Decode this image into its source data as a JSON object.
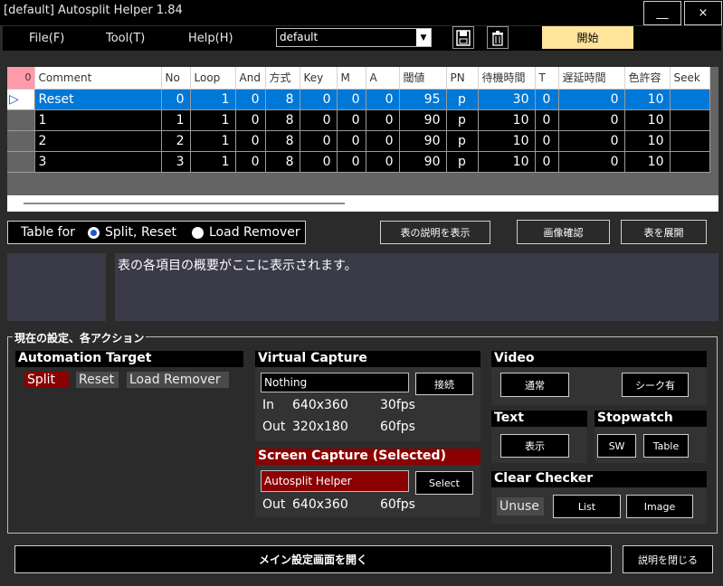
{
  "window": {
    "title": "[default] Autosplit Helper 1.84",
    "minimize": "__",
    "close": "×"
  },
  "menu": {
    "file": "File(F)",
    "tool": "Tool(T)",
    "help": "Help(H)",
    "profile_value": "default",
    "start_label": "開始"
  },
  "table": {
    "corner": "0",
    "headers": [
      "Comment",
      "No",
      "Loop",
      "And",
      "方式",
      "Key",
      "M",
      "A",
      "閾値",
      "PN",
      "待機時間",
      "T",
      "遅延時間",
      "色許容",
      "Seek"
    ],
    "rows": [
      {
        "marker": "▷",
        "comment": "Reset",
        "no": "0",
        "loop": "1",
        "and": "0",
        "method": "8",
        "key": "0",
        "m": "0",
        "a": "0",
        "threshold": "95",
        "pn": "p",
        "wait": "30",
        "t": "0",
        "delay": "0",
        "color_tol": "10",
        "seek": ""
      },
      {
        "marker": "",
        "comment": "1",
        "no": "1",
        "loop": "1",
        "and": "0",
        "method": "8",
        "key": "0",
        "m": "0",
        "a": "0",
        "threshold": "90",
        "pn": "p",
        "wait": "10",
        "t": "0",
        "delay": "0",
        "color_tol": "10",
        "seek": ""
      },
      {
        "marker": "",
        "comment": "2",
        "no": "2",
        "loop": "1",
        "and": "0",
        "method": "8",
        "key": "0",
        "m": "0",
        "a": "0",
        "threshold": "90",
        "pn": "p",
        "wait": "10",
        "t": "0",
        "delay": "0",
        "color_tol": "10",
        "seek": ""
      },
      {
        "marker": "",
        "comment": "3",
        "no": "3",
        "loop": "1",
        "and": "0",
        "method": "8",
        "key": "0",
        "m": "0",
        "a": "0",
        "threshold": "90",
        "pn": "p",
        "wait": "10",
        "t": "0",
        "delay": "0",
        "color_tol": "10",
        "seek": ""
      }
    ]
  },
  "table_for": {
    "label": "Table for",
    "opt1": "Split, Reset",
    "opt2": "Load Remover",
    "selected": "Split, Reset"
  },
  "buttons": {
    "show_table_desc": "表の説明を表示",
    "image_check": "画像確認",
    "expand_table": "表を展開"
  },
  "description": {
    "text": "表の各項目の概要がここに表示されます。"
  },
  "actions": {
    "title": "現在の設定、各アクション",
    "automation_target": {
      "head": "Automation Target",
      "split": "Split",
      "reset": "Reset",
      "load_remover": "Load Remover"
    },
    "virtual_capture": {
      "head": "Virtual Capture",
      "source": "Nothing",
      "connect": "接続",
      "in_label": "In",
      "in_res": "640x360",
      "in_fps": "30fps",
      "out_label": "Out",
      "out_res": "320x180",
      "out_fps": "60fps"
    },
    "screen_capture": {
      "head": "Screen Capture (Selected)",
      "source": "Autosplit Helper",
      "select": "Select",
      "out_label": "Out",
      "out_res": "640x360",
      "out_fps": "60fps"
    },
    "video": {
      "head": "Video",
      "normal": "通常",
      "seek": "シーク有"
    },
    "text": {
      "head": "Text",
      "show": "表示"
    },
    "stopwatch": {
      "head": "Stopwatch",
      "sw": "SW",
      "table": "Table"
    },
    "clear_checker": {
      "head": "Clear Checker",
      "unuse": "Unuse",
      "list": "List",
      "image": "Image"
    }
  },
  "footer": {
    "open_main": "メイン設定画面を開く",
    "close_desc": "説明を閉じる"
  },
  "colors": {
    "accent_blue": "#0078d7",
    "start_yellow": "#ffe49a",
    "active_red": "#8b0000"
  }
}
